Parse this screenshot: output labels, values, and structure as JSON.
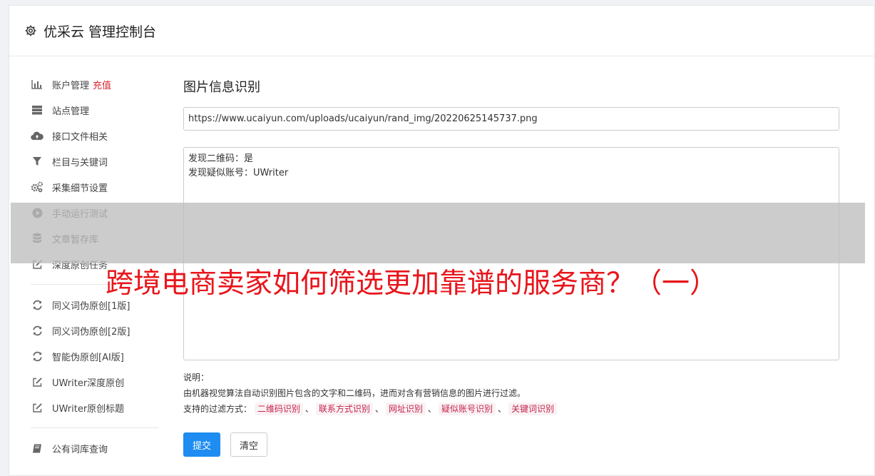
{
  "header": {
    "title": "优采云 管理控制台",
    "icon": "gear-icon"
  },
  "sidebar": {
    "groups": [
      [
        {
          "label": "账户管理",
          "badge": "充值",
          "icon": "bar-chart-icon"
        },
        {
          "label": "站点管理",
          "icon": "server-icon"
        },
        {
          "label": "接口文件相关",
          "icon": "cloud-upload-icon"
        },
        {
          "label": "栏目与关键词",
          "icon": "filter-icon"
        },
        {
          "label": "采集细节设置",
          "icon": "gears-icon"
        },
        {
          "label": "手动运行测试",
          "icon": "play-circle-icon"
        },
        {
          "label": "文章暂存库",
          "icon": "database-icon"
        },
        {
          "label": "深度原创任务",
          "icon": "edit-icon"
        }
      ],
      [
        {
          "label": "同义词伪原创[1版]",
          "icon": "refresh-icon"
        },
        {
          "label": "同义词伪原创[2版]",
          "icon": "refresh-icon"
        },
        {
          "label": "智能伪原创[AI版]",
          "icon": "refresh-icon"
        },
        {
          "label": "UWriter深度原创",
          "icon": "edit-icon"
        },
        {
          "label": "UWriter原创标题",
          "icon": "edit-icon"
        }
      ],
      [
        {
          "label": "公有词库查询",
          "icon": "book-icon"
        }
      ]
    ]
  },
  "main": {
    "title": "图片信息识别",
    "url_value": "https://www.ucaiyun.com/uploads/ucaiyun/rand_img/20220625145737.png",
    "result_lines": [
      "发现二维码：是",
      "发现疑似账号：UWriter"
    ],
    "help_label": "说明：",
    "help_desc": "由机器视觉算法自动识别图片包含的文字和二维码，进而对含有营销信息的图片进行过滤。",
    "filters_label": "支持的过滤方式：",
    "filters": [
      "二维码识别",
      "联系方式识别",
      "网址识别",
      "疑似账号识别",
      "关键词识别"
    ],
    "filter_separator": "、",
    "submit_label": "提交",
    "clear_label": "清空"
  },
  "overlay": {
    "text": "跨境电商卖家如何筛选更加靠谱的服务商？（一）"
  }
}
